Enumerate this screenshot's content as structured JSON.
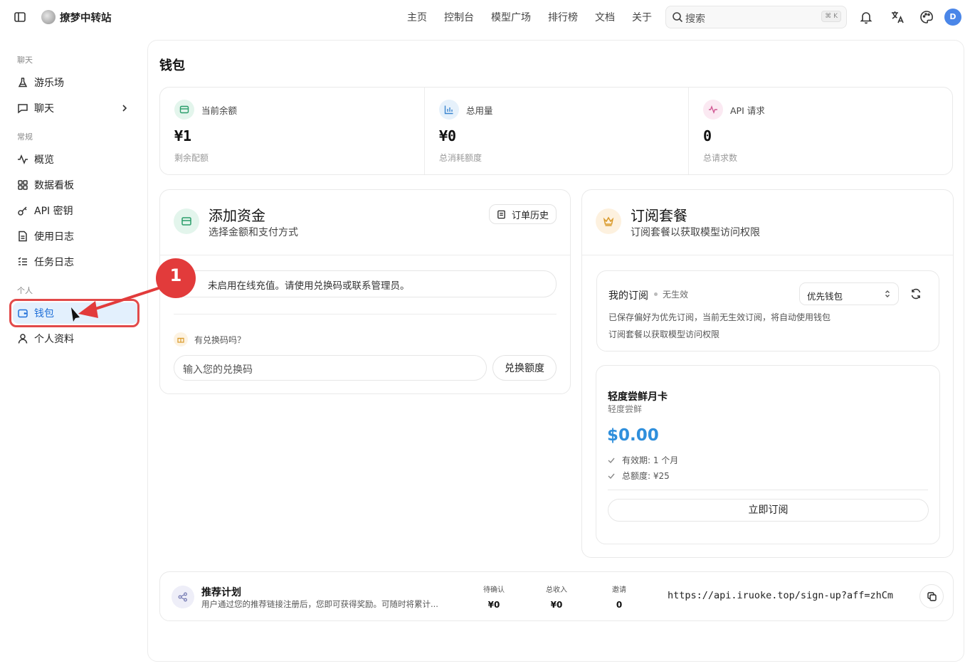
{
  "header": {
    "site_title": "撩梦中转站",
    "nav": [
      "主页",
      "控制台",
      "模型广场",
      "排行榜",
      "文档",
      "关于"
    ],
    "search_placeholder": "搜索",
    "search_shortcut": "⌘ K",
    "avatar_initial": "D",
    "icons": [
      "sidebar-toggle-icon",
      "bell-icon",
      "translate-icon",
      "palette-icon"
    ]
  },
  "sidebar": {
    "sections": {
      "chat": "聊天",
      "general": "常规",
      "personal": "个人"
    },
    "items": [
      {
        "label": "游乐场",
        "icon": "flask-icon"
      },
      {
        "label": "聊天",
        "icon": "message-icon"
      },
      {
        "label": "概览",
        "icon": "activity-icon"
      },
      {
        "label": "数据看板",
        "icon": "grid-icon"
      },
      {
        "label": "API 密钥",
        "icon": "key-icon"
      },
      {
        "label": "使用日志",
        "icon": "file-icon"
      },
      {
        "label": "任务日志",
        "icon": "list-icon"
      },
      {
        "label": "钱包",
        "icon": "wallet-icon",
        "active": true
      },
      {
        "label": "个人资料",
        "icon": "user-icon"
      }
    ]
  },
  "page": {
    "title": "钱包"
  },
  "stats": [
    {
      "label": "当前余额",
      "value": "¥1",
      "sub": "剩余配额",
      "color": "#e3f5ec"
    },
    {
      "label": "总用量",
      "value": "¥0",
      "sub": "总消耗额度",
      "color": "#e6f1fb"
    },
    {
      "label": "API 请求",
      "value": "0",
      "sub": "总请求数",
      "color": "#fbe9f2"
    }
  ],
  "funds": {
    "title": "添加资金",
    "subtitle": "选择金额和支付方式",
    "history_button": "订单历史",
    "notice": "未启用在线充值。请使用兑换码或联系管理员。",
    "redeem_label": "有兑换码吗？",
    "redeem_placeholder": "输入您的兑换码",
    "redeem_button": "兑换额度"
  },
  "subscription": {
    "title": "订阅套餐",
    "subtitle": "订阅套餐以获取模型访问权限",
    "my_title": "我的订阅",
    "my_status": "无生效",
    "select_value": "优先钱包",
    "line1": "已保存偏好为优先订阅，当前无生效订阅，将自动使用钱包",
    "line2": "订阅套餐以获取模型访问权限",
    "plan": {
      "name": "轻度尝鲜月卡",
      "sub": "轻度尝鲜",
      "price": "$0.00",
      "features": [
        "有效期: 1 个月",
        "总额度: ¥25"
      ],
      "button": "立即订阅"
    }
  },
  "referral": {
    "title": "推荐计划",
    "desc": "用户通过您的推荐链接注册后，您即可获得奖励。可随时将累计...",
    "stats": [
      {
        "label": "待确认",
        "value": "¥0"
      },
      {
        "label": "总收入",
        "value": "¥0"
      },
      {
        "label": "邀请",
        "value": "0"
      }
    ],
    "link": "https://api.iruoke.top/sign-up?aff=zhCm"
  },
  "annotation": {
    "number": "1"
  }
}
